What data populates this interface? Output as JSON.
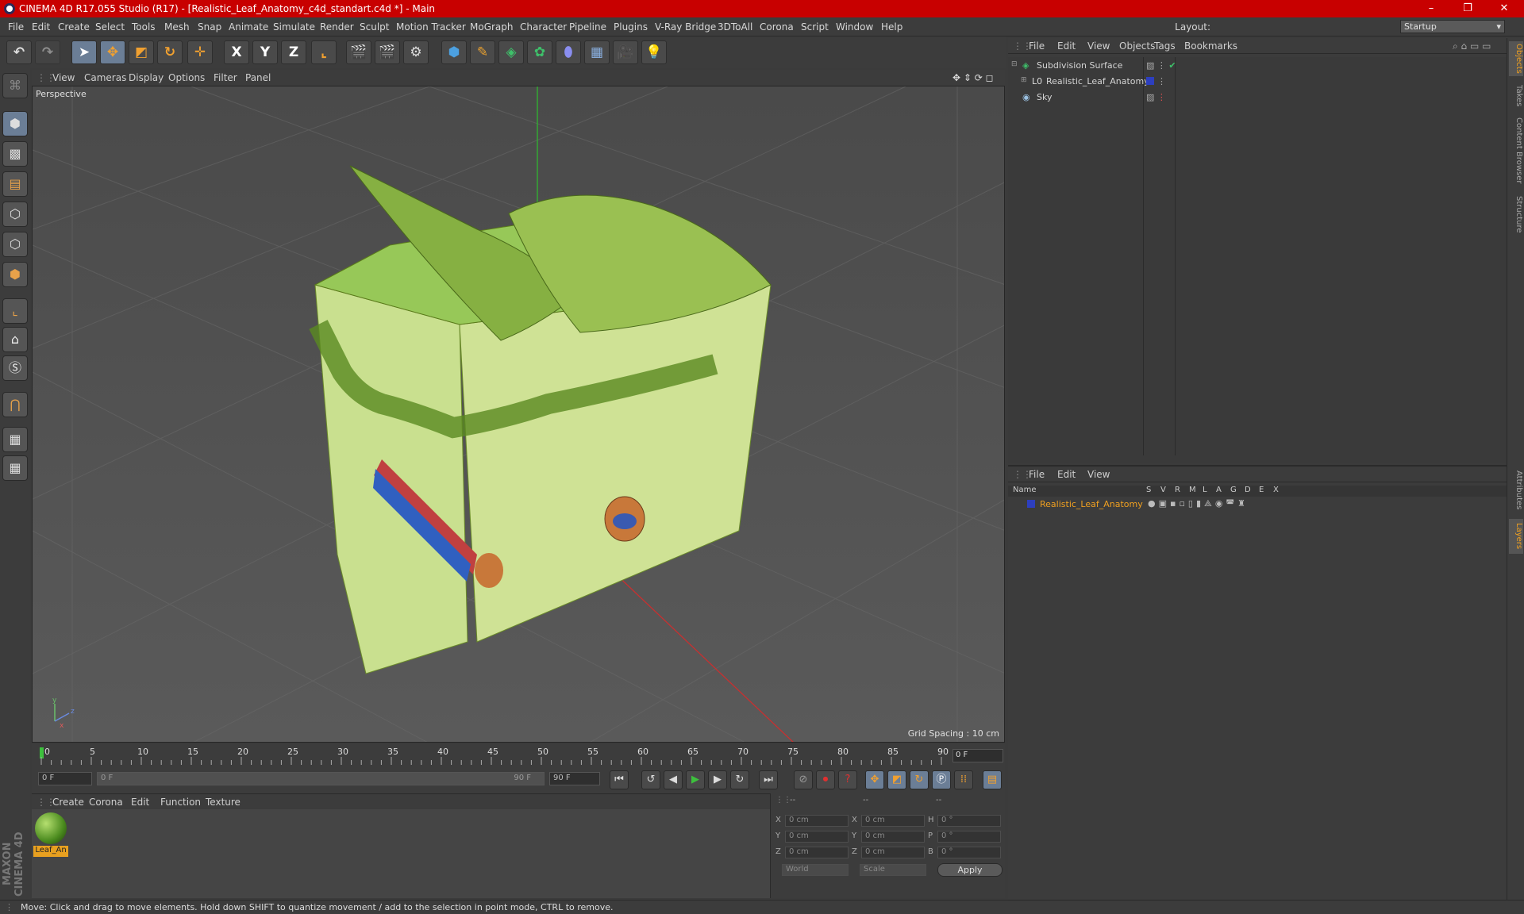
{
  "app": {
    "title": "CINEMA 4D R17.055 Studio (R17) - [Realistic_Leaf_Anatomy_c4d_standart.c4d *] - Main",
    "window_controls": {
      "minimize": "–",
      "maximize": "❐",
      "close": "✕"
    }
  },
  "menubar": {
    "items": [
      "File",
      "Edit",
      "Create",
      "Select",
      "Tools",
      "Mesh",
      "Snap",
      "Animate",
      "Simulate",
      "Render",
      "Sculpt",
      "Motion Tracker",
      "MoGraph",
      "Character",
      "Pipeline",
      "Plugins",
      "V-Ray Bridge",
      "3DToAll",
      "Corona",
      "Script",
      "Window",
      "Help"
    ],
    "layout_label": "Layout:",
    "layout_value": "Startup"
  },
  "toolbar": {
    "undo_icon": "undo-icon",
    "axis_x": "X",
    "axis_y": "Y",
    "axis_z": "Z"
  },
  "viewport": {
    "menu": [
      "View",
      "Cameras",
      "Display",
      "Options",
      "Filter",
      "Panel"
    ],
    "label": "Perspective",
    "grid_spacing": "Grid Spacing : 10 cm"
  },
  "timeline": {
    "ticks": [
      "0",
      "5",
      "10",
      "15",
      "20",
      "25",
      "30",
      "35",
      "40",
      "45",
      "50",
      "55",
      "60",
      "65",
      "70",
      "75",
      "80",
      "85",
      "90"
    ],
    "current_frame": "0 F",
    "start_field": "0 F",
    "range_start": "0 F",
    "range_end": "90 F",
    "end_field": "90 F"
  },
  "materials": {
    "menu": [
      "Create",
      "Corona",
      "Edit",
      "Function",
      "Texture"
    ],
    "items": [
      {
        "label": "Leaf_An"
      }
    ]
  },
  "coordinates": {
    "headers": [
      "--",
      "--",
      "--"
    ],
    "rows": [
      {
        "axis": "X",
        "pos": "0 cm",
        "axis2": "X",
        "size": "0 cm",
        "rot_axis": "H",
        "rot": "0 °"
      },
      {
        "axis": "Y",
        "pos": "0 cm",
        "axis2": "Y",
        "size": "0 cm",
        "rot_axis": "P",
        "rot": "0 °"
      },
      {
        "axis": "Z",
        "pos": "0 cm",
        "axis2": "Z",
        "size": "0 cm",
        "rot_axis": "B",
        "rot": "0 °"
      }
    ],
    "mode": "World",
    "scale": "Scale",
    "apply": "Apply"
  },
  "object_manager": {
    "menu": [
      "File",
      "Edit",
      "View",
      "Objects",
      "Tags",
      "Bookmarks"
    ],
    "objects": [
      {
        "name": "Subdivision Surface"
      },
      {
        "name": "Realistic_Leaf_Anatomy"
      },
      {
        "name": "Sky"
      }
    ]
  },
  "layer_manager": {
    "menu": [
      "File",
      "Edit",
      "View"
    ],
    "columns": [
      "Name",
      "S",
      "V",
      "R",
      "M",
      "L",
      "A",
      "G",
      "D",
      "E",
      "X"
    ],
    "layers": [
      {
        "name": "Realistic_Leaf_Anatomy",
        "color": "#2d3fbf"
      }
    ]
  },
  "right_tabs": [
    "Objects",
    "Takes",
    "Content Browser",
    "Structure",
    "Attributes",
    "Layers"
  ],
  "brand": "MAXON CINEMA 4D",
  "status": "Move: Click and drag to move elements. Hold down SHIFT to quantize movement / add to the selection in point mode, CTRL to remove."
}
